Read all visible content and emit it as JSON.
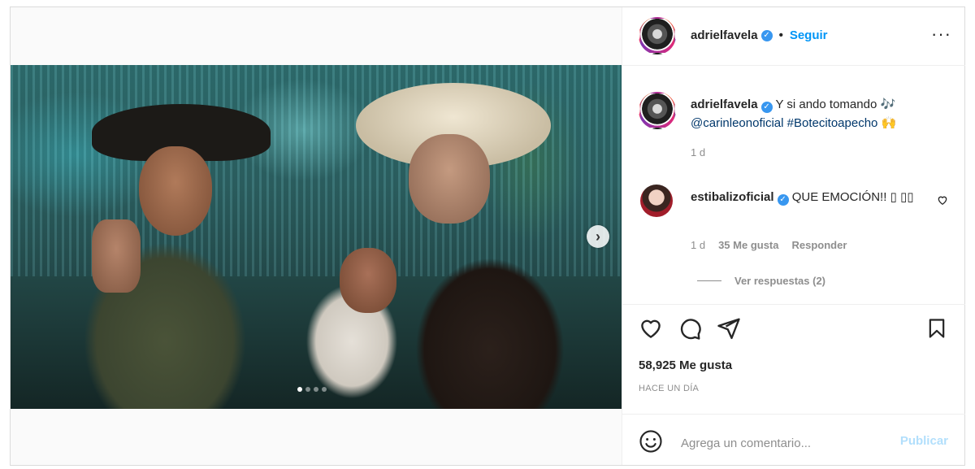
{
  "post": {
    "username": "adrielfavela",
    "follow_label": "Seguir",
    "separator": "•",
    "caption": {
      "text": "Y si ando tomando 🎶",
      "mention": "@carinleonoficial",
      "hashtag": "#Botecitoapecho",
      "emoji": "🙌"
    },
    "caption_time": "1 d",
    "likes": "58,925 Me gusta",
    "posted": "HACE UN DÍA",
    "carousel": {
      "slide_count": 4,
      "active_index": 0
    }
  },
  "comment": {
    "username": "estibalizoficial",
    "text": "QUE EMOCIÓN!! ▯ ▯▯",
    "time": "1 d",
    "likes": "35 Me gusta",
    "reply_label": "Responder",
    "view_replies": "Ver respuestas (2)"
  },
  "composer": {
    "placeholder": "Agrega un comentario...",
    "publish_label": "Publicar"
  },
  "colors": {
    "accent": "#0095f6",
    "verified": "#3897f0",
    "publish_disabled": "#b2dffc",
    "muted": "#8e8e8e"
  },
  "icons": [
    "verified-badge-icon",
    "more-options-icon",
    "heart-icon",
    "comment-icon",
    "share-icon",
    "bookmark-icon",
    "emoji-icon",
    "chevron-right-icon"
  ]
}
